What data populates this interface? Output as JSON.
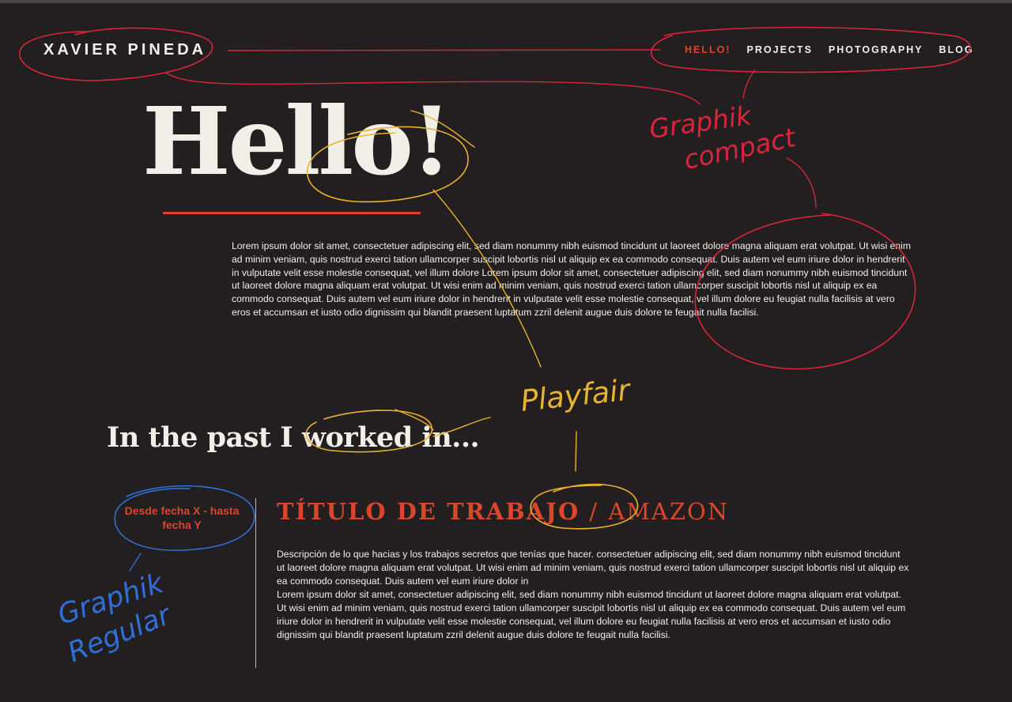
{
  "header": {
    "logo": "XAVIER PINEDA",
    "nav": [
      {
        "label": "HELLO!"
      },
      {
        "label": "PROJECTS"
      },
      {
        "label": "PHOTOGRAPHY"
      },
      {
        "label": "BLOG"
      }
    ]
  },
  "hero": {
    "title": "Hello!",
    "intro": "Lorem ipsum dolor sit amet, consectetuer adipiscing elit, sed diam nonummy nibh euismod tincidunt ut laoreet dolore magna aliquam erat volutpat. Ut wisi enim ad minim veniam, quis nostrud exerci tation ullamcorper suscipit lobortis nisl ut aliquip ex ea commodo consequat. Duis autem vel eum iriure dolor in hendrerit in vulputate velit esse molestie consequat, vel illum dolore Lorem ipsum dolor sit amet, consectetuer adipiscing elit, sed diam nonummy nibh euismod tincidunt ut laoreet dolore magna aliquam erat volutpat. Ut wisi enim ad minim veniam, quis nostrud exerci tation ullamcorper suscipit lobortis nisl ut aliquip ex ea commodo consequat. Duis autem vel eum iriure dolor in hendrerit in vulputate velit esse molestie consequat, vel illum dolore eu feugiat nulla facilisis at vero eros et accumsan et iusto odio dignissim qui blandit praesent luptatum zzril delenit augue duis dolore te feugait nulla facilisi."
  },
  "experience": {
    "heading": "In the past I worked in...",
    "jobs": [
      {
        "dates": "Desde fecha X - hasta fecha Y",
        "role": "TÍTULO DE TRABAJO",
        "separator": "/",
        "company": "AMAZON",
        "description_1": "Descripción de lo que hacias y los trabajos secretos que tenías que hacer. consectetuer adipiscing elit, sed diam nonummy nibh euismod tincidunt ut laoreet dolore magna aliquam erat volutpat. Ut wisi enim ad minim veniam, quis nostrud exerci tation ullamcorper suscipit lobortis nisl ut aliquip ex ea commodo consequat. Duis autem vel eum iriure dolor in",
        "description_2": "Lorem ipsum dolor sit amet, consectetuer adipiscing elit, sed diam nonummy nibh euismod tincidunt ut laoreet dolore magna aliquam erat volutpat. Ut wisi enim ad minim veniam, quis nostrud exerci tation ullamcorper suscipit lobortis nisl ut aliquip ex ea commodo consequat. Duis autem vel eum iriure dolor in hendrerit in vulputate velit esse molestie consequat, vel illum dolore eu feugiat nulla facilisis at vero eros et accumsan et iusto odio dignissim qui blandit praesent luptatum zzril delenit augue duis dolore te feugait nulla facilisi."
      }
    ]
  },
  "annotations": {
    "nav_font": [
      "Graphik",
      "compact"
    ],
    "heading_font": "Playfair",
    "body_font": [
      "Graphik",
      "Regular"
    ]
  },
  "colors": {
    "background": "#231f20",
    "text": "#f2efe9",
    "accent": "#d9462b",
    "annotation_red": "#d9253a",
    "annotation_yellow": "#e8b32e",
    "annotation_blue": "#2f6fd8"
  }
}
